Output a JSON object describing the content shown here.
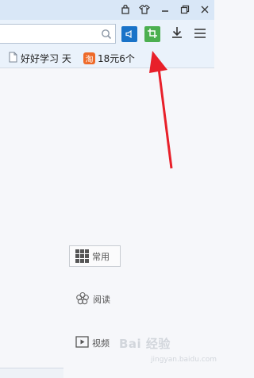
{
  "address_bar": {
    "value": "",
    "placeholder": ""
  },
  "bookmarks": [
    {
      "label": "好好学习 天"
    },
    {
      "badge": "淘",
      "label": "18元6个"
    }
  ],
  "sidebar_nav": [
    {
      "label": "常用"
    },
    {
      "label": "阅读"
    },
    {
      "label": "视频"
    }
  ],
  "watermark": {
    "text": "Bai 经验",
    "sub": "jingyan.baidu.com"
  },
  "icons": [
    "bag-icon",
    "shirt-icon",
    "minimize-icon",
    "restore-icon",
    "search-icon",
    "speaker-icon",
    "crop-icon",
    "download-icon",
    "menu-icon",
    "page-icon",
    "grid-icon",
    "flower-icon",
    "video-icon",
    "red-arrow"
  ],
  "colors": {
    "speaker_btn": "#1a73c8",
    "crop_btn": "#4caf50",
    "arrow": "#e8202a",
    "titlebar": "#d9e7f7",
    "toolbar": "#eaf2fb"
  }
}
